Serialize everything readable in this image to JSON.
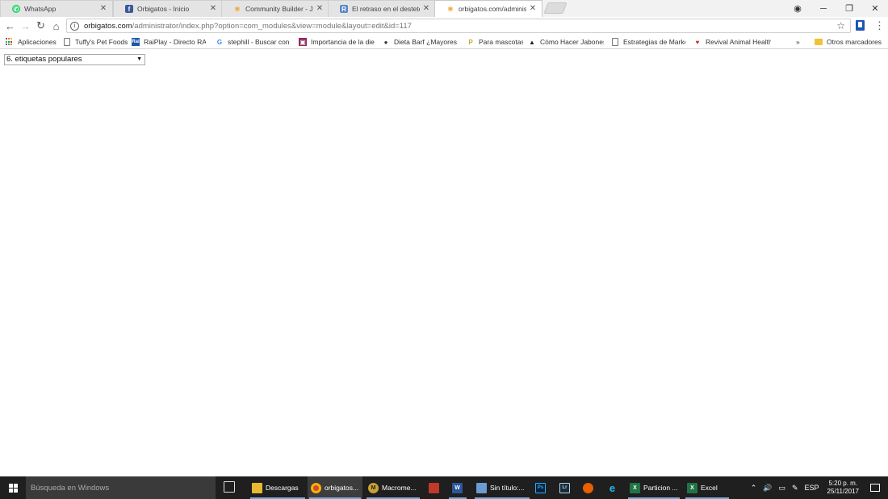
{
  "browser": {
    "tabs": [
      {
        "title": "WhatsApp",
        "icon": "whatsapp-icon",
        "color": "#25d366"
      },
      {
        "title": "Orbigatos - Inicio",
        "icon": "facebook-icon",
        "color": "#3b5998"
      },
      {
        "title": "Community Builder - Jo",
        "icon": "joomla-icon",
        "color": "#f4a534"
      },
      {
        "title": "El retraso en el destete n",
        "icon": "page-icon",
        "color": "#5b8ac7"
      },
      {
        "title": "orbigatos.com/administ",
        "icon": "joomla-icon",
        "color": "#f4a534"
      }
    ],
    "url_host": "orbigatos.com",
    "url_rest": "/administrator/index.php?option=com_modules&view=module&layout=edit&id=117"
  },
  "bookmarks": {
    "apps_label": "Aplicaciones",
    "items": [
      {
        "label": "Tuffy's Pet Foods",
        "icon": "document-icon"
      },
      {
        "label": "RaiPlay - Directo RAI",
        "icon": "raiplay-icon"
      },
      {
        "label": "stephill - Buscar con",
        "icon": "google-icon"
      },
      {
        "label": "Importancia de la die",
        "icon": "site-icon"
      },
      {
        "label": "Dieta Barf ¿Mayores",
        "icon": "dog-icon"
      },
      {
        "label": "Para mascotas",
        "icon": "pinterest-icon"
      },
      {
        "label": "Cómo Hacer Jabones",
        "icon": "bottle-icon"
      },
      {
        "label": "Estrategias de Marke",
        "icon": "document-icon"
      },
      {
        "label": "Revival Animal Health",
        "icon": "heart-icon"
      }
    ],
    "overflow": "»",
    "other_label": "Otros marcadores"
  },
  "page": {
    "select_value": "6. etiquetas populares"
  },
  "taskbar": {
    "search_placeholder": "Búsqueda en Windows",
    "items": [
      {
        "label": "Descargas",
        "icon": "folder-icon"
      },
      {
        "label": "orbigatos...",
        "icon": "chrome-icon"
      },
      {
        "label": "Macrome...",
        "icon": "dreamweaver-icon"
      },
      {
        "label": "",
        "icon": "app-icon"
      },
      {
        "label": "",
        "icon": "word-icon"
      },
      {
        "label": "Sin título:...",
        "icon": "paint-icon"
      },
      {
        "label": "",
        "icon": "photoshop-icon"
      },
      {
        "label": "",
        "icon": "lightroom-icon"
      },
      {
        "label": "",
        "icon": "firefox-icon"
      },
      {
        "label": "",
        "icon": "ie-icon"
      },
      {
        "label": "Particion ...",
        "icon": "excel-icon"
      },
      {
        "label": "Excel",
        "icon": "excel-icon"
      }
    ],
    "language": "ESP",
    "time": "5:20 p. m.",
    "date": "25/11/2017"
  }
}
